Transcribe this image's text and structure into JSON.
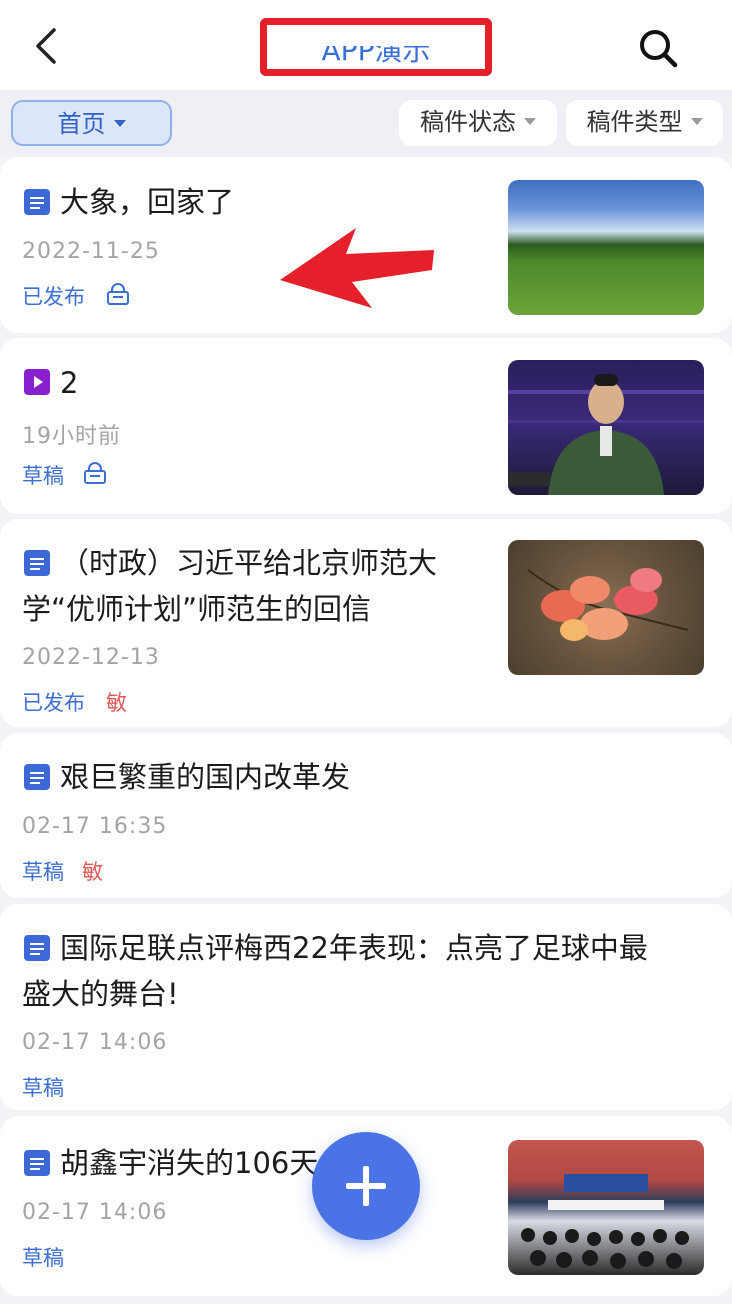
{
  "header": {
    "title": "APP演示",
    "back_icon": "chevron-left-icon",
    "search_icon": "search-icon",
    "highlight_color": "#e5202a"
  },
  "filters": {
    "home": "首页",
    "status": "稿件状态",
    "type": "稿件类型"
  },
  "articles": [
    {
      "icon": "document-icon",
      "title_lines": [
        "大象，回家了"
      ],
      "date": "2022-11-25",
      "status": "已发布",
      "badge": "lock-icon",
      "thumb": "grassland-field-image"
    },
    {
      "icon": "video-icon",
      "title_lines": [
        "2"
      ],
      "date": "19小时前",
      "status": "草稿",
      "badge": "lock-icon",
      "thumb": "news-anchor-image"
    },
    {
      "icon": "document-icon",
      "title_lines": [
        "（时政）习近平给北京师范大",
        "学“优师计划”师范生的回信"
      ],
      "date": "2022-12-13",
      "status": "已发布",
      "badge": "敏",
      "thumb": "autumn-leaves-image"
    },
    {
      "icon": "document-icon",
      "title_lines": [
        "艰巨繁重的国内改革发"
      ],
      "date": "02-17 16:35",
      "status": "草稿",
      "badge": "敏"
    },
    {
      "icon": "document-icon",
      "title_lines": [
        "国际足联点评梅西22年表现：点亮了足球中最",
        "盛大的舞台!"
      ],
      "date": "02-17 14:06",
      "status": "草稿"
    },
    {
      "icon": "document-icon",
      "title_lines": [
        "胡鑫宇消失的106天"
      ],
      "date": "02-17 14:06",
      "status": "草稿",
      "thumb": "press-conference-image"
    }
  ],
  "fab_icon": "plus-icon",
  "annotation": "red-arrow",
  "colors": {
    "accent": "#3b6fd2",
    "sensitive": "#e05a5a",
    "fab": "#4a74e6"
  }
}
